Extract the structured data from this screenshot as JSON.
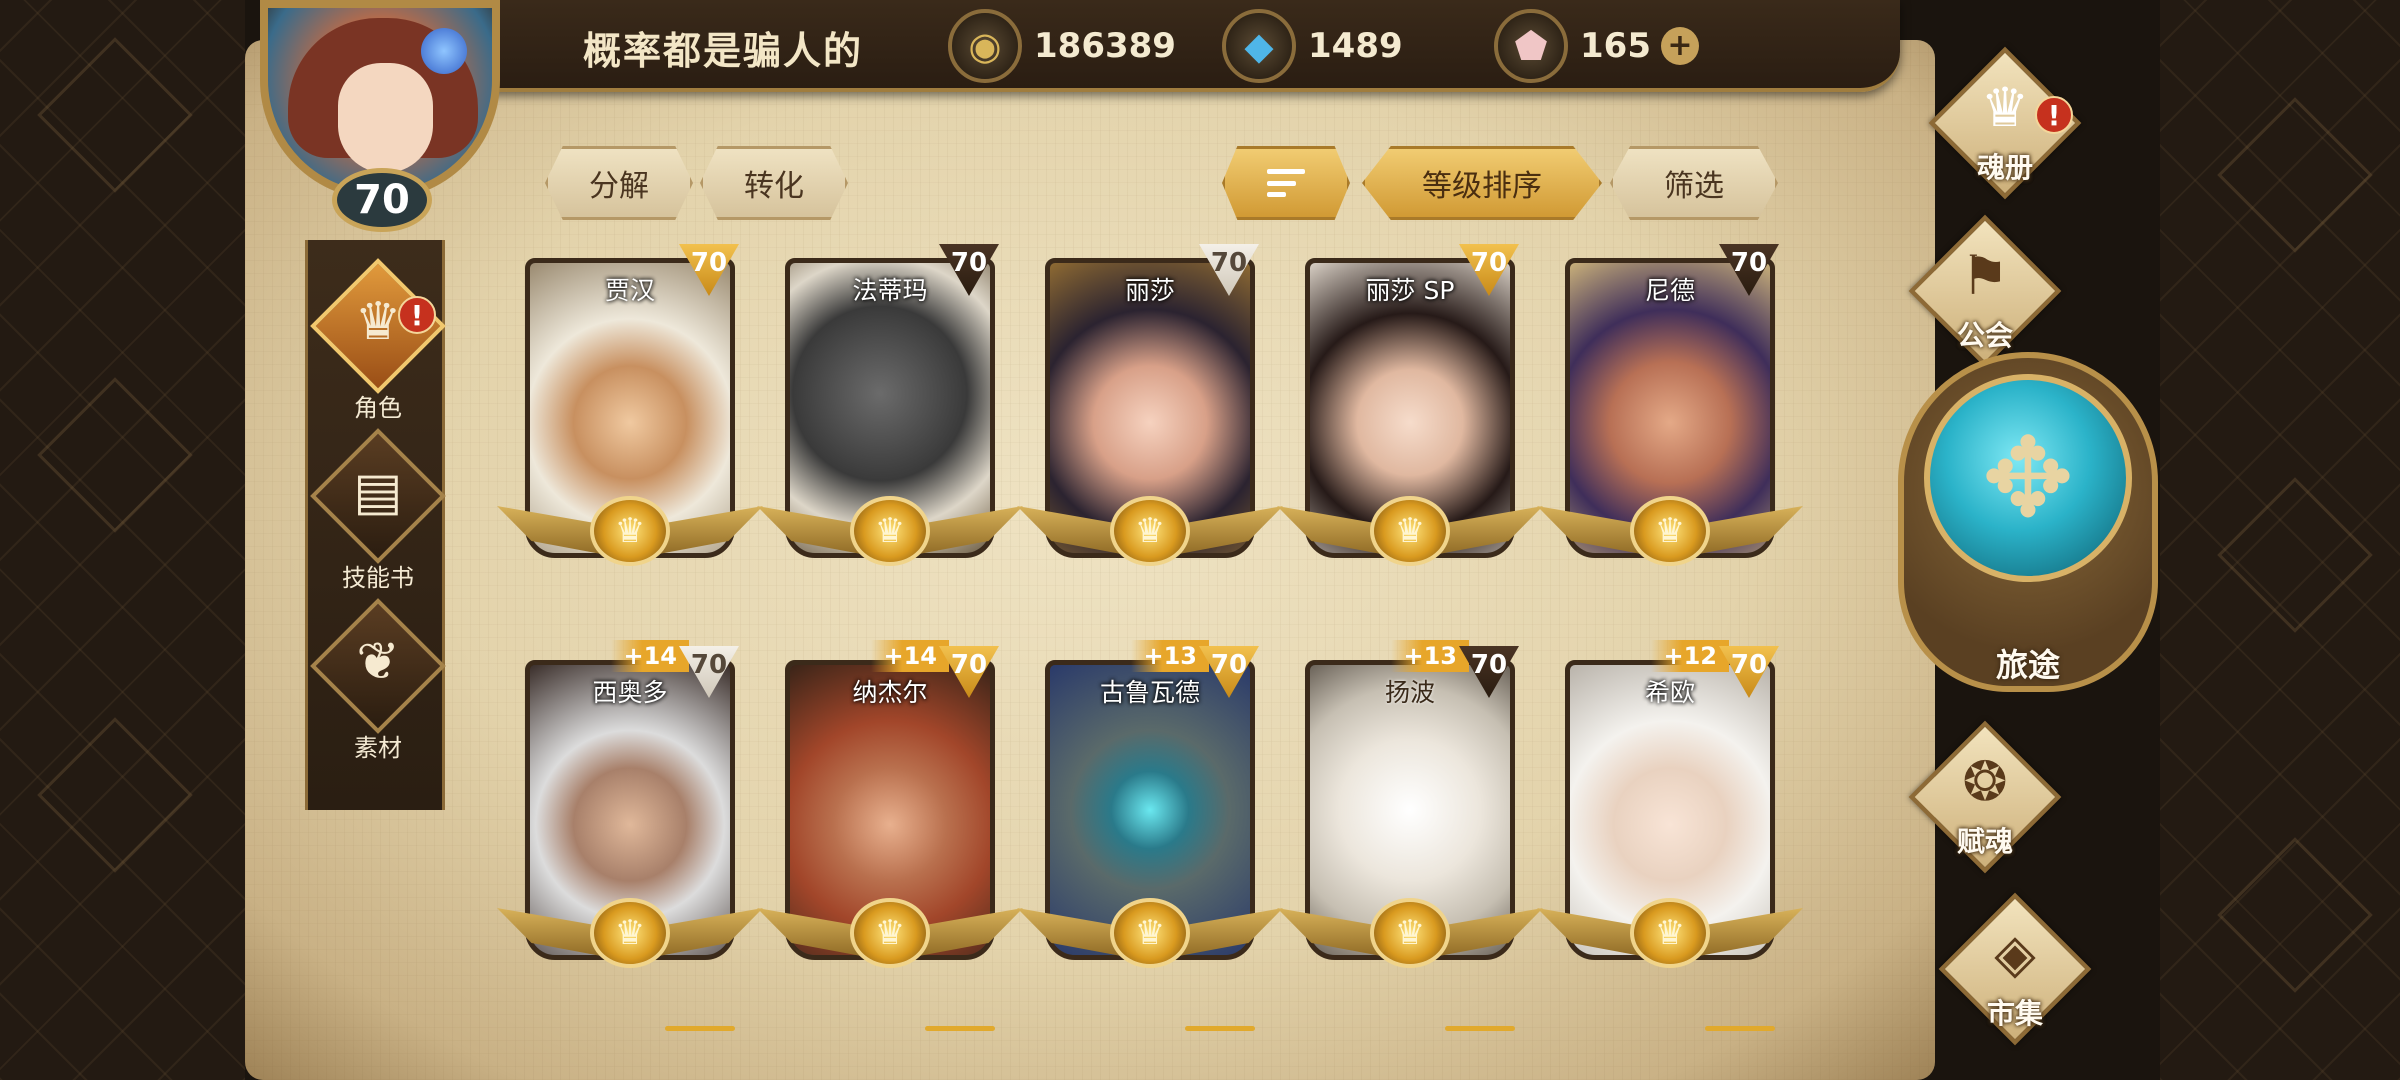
{
  "player": {
    "name": "概率都是骗人的",
    "level": "70"
  },
  "currencies": [
    {
      "icon": "gold-coin-icon",
      "value": "186389"
    },
    {
      "icon": "blue-crystal-icon",
      "value": "1489"
    },
    {
      "icon": "pink-gem-icon",
      "value": "165"
    }
  ],
  "left_nav": [
    {
      "label": "角色",
      "icon": "character-icon",
      "alert": "!"
    },
    {
      "label": "技能书",
      "icon": "skill-book-icon"
    },
    {
      "label": "素材",
      "icon": "material-icon"
    }
  ],
  "toolbar": {
    "decompose": "分解",
    "convert": "转化",
    "sort_by_level": "等级排序",
    "filter": "筛选"
  },
  "heroes": [
    {
      "name": "贾汉",
      "level": "70",
      "plus": ""
    },
    {
      "name": "法蒂玛",
      "level": "70",
      "plus": ""
    },
    {
      "name": "丽莎",
      "level": "70",
      "plus": ""
    },
    {
      "name": "丽莎 SP",
      "level": "70",
      "plus": ""
    },
    {
      "name": "尼德",
      "level": "70",
      "plus": ""
    },
    {
      "name": "西奥多",
      "level": "70",
      "plus": "+14"
    },
    {
      "name": "纳杰尔",
      "level": "70",
      "plus": "+14"
    },
    {
      "name": "古鲁瓦德",
      "level": "70",
      "plus": "+13"
    },
    {
      "name": "扬波",
      "level": "70",
      "plus": "+13"
    },
    {
      "name": "希欧",
      "level": "70",
      "plus": "+12"
    }
  ],
  "right_menu": {
    "soul_book": "魂册",
    "soul_book_alert": "!",
    "guild": "公会",
    "journey": "旅途",
    "endow_soul": "赋魂",
    "market": "市集"
  },
  "currency_add": "+"
}
